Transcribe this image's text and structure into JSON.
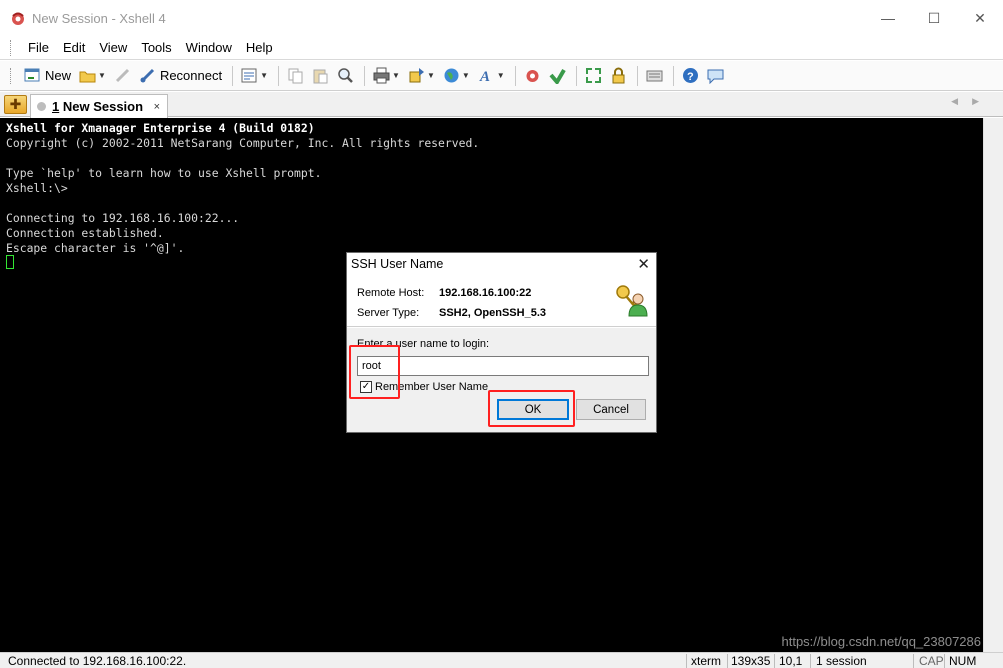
{
  "window": {
    "title": "New Session - Xshell 4",
    "minimize": "—",
    "maximize": "☐",
    "close": "✕"
  },
  "menu": [
    "File",
    "Edit",
    "View",
    "Tools",
    "Window",
    "Help"
  ],
  "toolbar": {
    "new_label": "New",
    "reconnect_label": "Reconnect"
  },
  "tab": {
    "number": "1",
    "title": "New Session",
    "close": "×"
  },
  "terminal": {
    "lines": [
      "Xshell for Xmanager Enterprise 4 (Build 0182)",
      "Copyright (c) 2002-2011 NetSarang Computer, Inc. All rights reserved.",
      "",
      "Type `help' to learn how to use Xshell prompt.",
      "Xshell:\\>",
      "",
      "Connecting to 192.168.16.100:22...",
      "Connection established.",
      "Escape character is '^@]'."
    ]
  },
  "dialog": {
    "title": "SSH User Name",
    "close": "✕",
    "remote_host_label": "Remote Host:",
    "remote_host_value": "192.168.16.100:22",
    "server_type_label": "Server Type:",
    "server_type_value": "SSH2, OpenSSH_5.3",
    "prompt": "Enter a user name to login:",
    "username": "root",
    "remember_label": "Remember User Name",
    "remember_checked": true,
    "ok_label": "OK",
    "cancel_label": "Cancel"
  },
  "status": {
    "connection": "Connected to 192.168.16.100:22.",
    "term_type": "xterm",
    "size": "139x35",
    "cursor_pos": "10,1",
    "sessions": "1 session",
    "cap": "CAP",
    "num": "NUM"
  },
  "watermark": "https://blog.csdn.net/qq_23807286",
  "colors": {
    "highlight": "#ff2020",
    "terminal_bg": "#000000",
    "cursor": "#33e633"
  }
}
